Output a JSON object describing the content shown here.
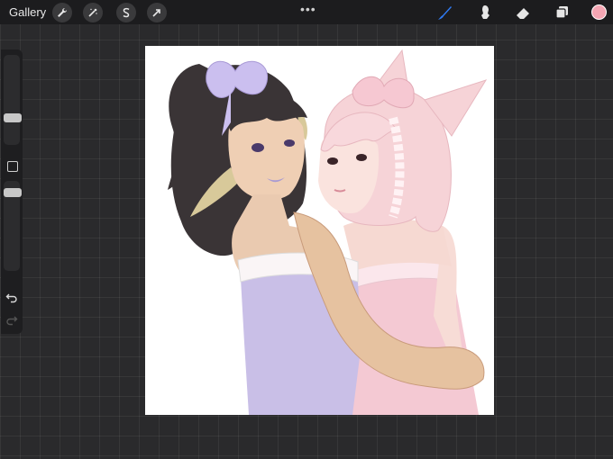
{
  "toolbar": {
    "gallery_label": "Gallery",
    "actions_icon": "wrench-icon",
    "adjustments_icon": "magic-wand-icon",
    "selection_icon": "s-selection-icon",
    "transform_icon": "arrow-cursor-icon",
    "more_label": "•••"
  },
  "tools": {
    "brush_icon": "brush-icon",
    "smudge_icon": "smudge-icon",
    "eraser_icon": "eraser-icon",
    "layers_icon": "layers-icon",
    "active_color": "#f4a6b3",
    "accent_color": "#2f7bf5"
  },
  "sidebar": {
    "brush_size_level": 0.72,
    "opacity_level": 0.0,
    "modify_icon": "square-icon",
    "undo_icon": "undo-icon",
    "redo_icon": "redo-icon"
  },
  "artwork": {
    "name": "digital-painting-two-girls-hugging"
  }
}
